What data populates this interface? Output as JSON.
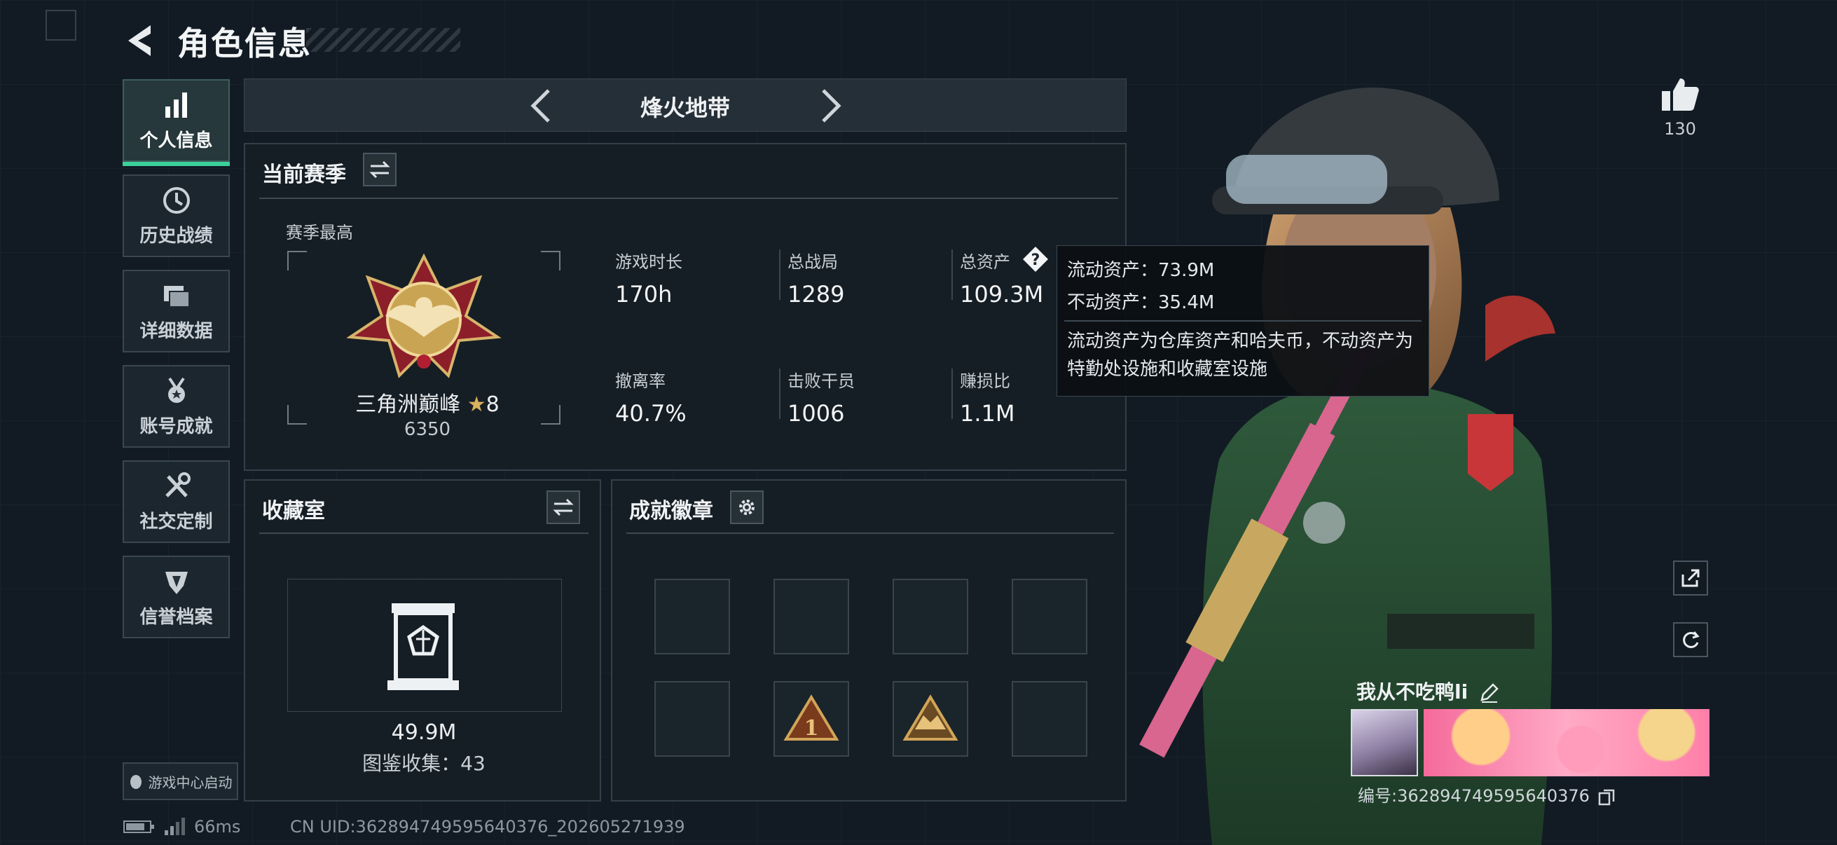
{
  "header": {
    "title": "角色信息"
  },
  "sidebar": {
    "items": [
      {
        "label": "个人信息",
        "icon": "bar-chart-icon",
        "active": true
      },
      {
        "label": "历史战绩",
        "icon": "clock-icon"
      },
      {
        "label": "详细数据",
        "icon": "stack-icon"
      },
      {
        "label": "账号成就",
        "icon": "medal-icon"
      },
      {
        "label": "社交定制",
        "icon": "tools-icon"
      },
      {
        "label": "信誉档案",
        "icon": "shield-icon"
      }
    ],
    "launch_label": "游戏中心启动"
  },
  "mode_nav": {
    "name": "烽火地带"
  },
  "season": {
    "title": "当前赛季",
    "best_label": "赛季最高",
    "rank_name": "三角洲巅峰",
    "rank_stars": "8",
    "rank_score": "6350",
    "stats": [
      {
        "label": "游戏时长",
        "value": "170h"
      },
      {
        "label": "总战局",
        "value": "1289"
      },
      {
        "label": "总资产",
        "value": "109.3M"
      },
      {
        "label": "撤离率",
        "value": "40.7%"
      },
      {
        "label": "击败干员",
        "value": "1006"
      },
      {
        "label": "赚损比",
        "value": "1.1M"
      }
    ]
  },
  "tooltip": {
    "liquid": "流动资产：73.9M",
    "fixed": "不动资产：35.4M",
    "desc": "流动资产为仓库资产和哈夫币，不动资产为特勤处设施和收藏室设施"
  },
  "collection": {
    "title": "收藏室",
    "value": "49.9M",
    "count": "图鉴收集：43"
  },
  "badges": {
    "title": "成就徽章",
    "slot_icons": [
      "",
      "",
      "",
      "",
      "",
      "badge-1-icon",
      "badge-eagle-icon",
      ""
    ]
  },
  "likes": {
    "count": "130"
  },
  "player": {
    "name": "我从不吃鸭li",
    "id": "编号:362894749595640376"
  },
  "status": {
    "ping": "66ms",
    "uid": "CN UID:362894749595640376_202605271939"
  },
  "colors": {
    "accent": "#3bd19a",
    "background": "#121b23",
    "gold": "#c9a453"
  }
}
